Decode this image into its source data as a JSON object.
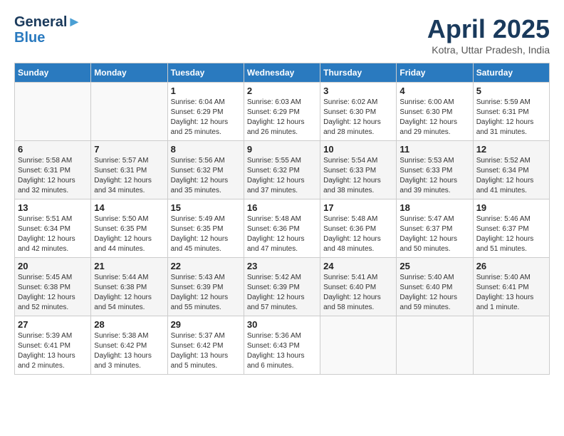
{
  "header": {
    "logo_line1": "General",
    "logo_line2": "Blue",
    "month_title": "April 2025",
    "location": "Kotra, Uttar Pradesh, India"
  },
  "weekdays": [
    "Sunday",
    "Monday",
    "Tuesday",
    "Wednesday",
    "Thursday",
    "Friday",
    "Saturday"
  ],
  "weeks": [
    [
      {
        "day": "",
        "sunrise": "",
        "sunset": "",
        "daylight": ""
      },
      {
        "day": "",
        "sunrise": "",
        "sunset": "",
        "daylight": ""
      },
      {
        "day": "1",
        "sunrise": "Sunrise: 6:04 AM",
        "sunset": "Sunset: 6:29 PM",
        "daylight": "Daylight: 12 hours and 25 minutes."
      },
      {
        "day": "2",
        "sunrise": "Sunrise: 6:03 AM",
        "sunset": "Sunset: 6:29 PM",
        "daylight": "Daylight: 12 hours and 26 minutes."
      },
      {
        "day": "3",
        "sunrise": "Sunrise: 6:02 AM",
        "sunset": "Sunset: 6:30 PM",
        "daylight": "Daylight: 12 hours and 28 minutes."
      },
      {
        "day": "4",
        "sunrise": "Sunrise: 6:00 AM",
        "sunset": "Sunset: 6:30 PM",
        "daylight": "Daylight: 12 hours and 29 minutes."
      },
      {
        "day": "5",
        "sunrise": "Sunrise: 5:59 AM",
        "sunset": "Sunset: 6:31 PM",
        "daylight": "Daylight: 12 hours and 31 minutes."
      }
    ],
    [
      {
        "day": "6",
        "sunrise": "Sunrise: 5:58 AM",
        "sunset": "Sunset: 6:31 PM",
        "daylight": "Daylight: 12 hours and 32 minutes."
      },
      {
        "day": "7",
        "sunrise": "Sunrise: 5:57 AM",
        "sunset": "Sunset: 6:31 PM",
        "daylight": "Daylight: 12 hours and 34 minutes."
      },
      {
        "day": "8",
        "sunrise": "Sunrise: 5:56 AM",
        "sunset": "Sunset: 6:32 PM",
        "daylight": "Daylight: 12 hours and 35 minutes."
      },
      {
        "day": "9",
        "sunrise": "Sunrise: 5:55 AM",
        "sunset": "Sunset: 6:32 PM",
        "daylight": "Daylight: 12 hours and 37 minutes."
      },
      {
        "day": "10",
        "sunrise": "Sunrise: 5:54 AM",
        "sunset": "Sunset: 6:33 PM",
        "daylight": "Daylight: 12 hours and 38 minutes."
      },
      {
        "day": "11",
        "sunrise": "Sunrise: 5:53 AM",
        "sunset": "Sunset: 6:33 PM",
        "daylight": "Daylight: 12 hours and 39 minutes."
      },
      {
        "day": "12",
        "sunrise": "Sunrise: 5:52 AM",
        "sunset": "Sunset: 6:34 PM",
        "daylight": "Daylight: 12 hours and 41 minutes."
      }
    ],
    [
      {
        "day": "13",
        "sunrise": "Sunrise: 5:51 AM",
        "sunset": "Sunset: 6:34 PM",
        "daylight": "Daylight: 12 hours and 42 minutes."
      },
      {
        "day": "14",
        "sunrise": "Sunrise: 5:50 AM",
        "sunset": "Sunset: 6:35 PM",
        "daylight": "Daylight: 12 hours and 44 minutes."
      },
      {
        "day": "15",
        "sunrise": "Sunrise: 5:49 AM",
        "sunset": "Sunset: 6:35 PM",
        "daylight": "Daylight: 12 hours and 45 minutes."
      },
      {
        "day": "16",
        "sunrise": "Sunrise: 5:48 AM",
        "sunset": "Sunset: 6:36 PM",
        "daylight": "Daylight: 12 hours and 47 minutes."
      },
      {
        "day": "17",
        "sunrise": "Sunrise: 5:48 AM",
        "sunset": "Sunset: 6:36 PM",
        "daylight": "Daylight: 12 hours and 48 minutes."
      },
      {
        "day": "18",
        "sunrise": "Sunrise: 5:47 AM",
        "sunset": "Sunset: 6:37 PM",
        "daylight": "Daylight: 12 hours and 50 minutes."
      },
      {
        "day": "19",
        "sunrise": "Sunrise: 5:46 AM",
        "sunset": "Sunset: 6:37 PM",
        "daylight": "Daylight: 12 hours and 51 minutes."
      }
    ],
    [
      {
        "day": "20",
        "sunrise": "Sunrise: 5:45 AM",
        "sunset": "Sunset: 6:38 PM",
        "daylight": "Daylight: 12 hours and 52 minutes."
      },
      {
        "day": "21",
        "sunrise": "Sunrise: 5:44 AM",
        "sunset": "Sunset: 6:38 PM",
        "daylight": "Daylight: 12 hours and 54 minutes."
      },
      {
        "day": "22",
        "sunrise": "Sunrise: 5:43 AM",
        "sunset": "Sunset: 6:39 PM",
        "daylight": "Daylight: 12 hours and 55 minutes."
      },
      {
        "day": "23",
        "sunrise": "Sunrise: 5:42 AM",
        "sunset": "Sunset: 6:39 PM",
        "daylight": "Daylight: 12 hours and 57 minutes."
      },
      {
        "day": "24",
        "sunrise": "Sunrise: 5:41 AM",
        "sunset": "Sunset: 6:40 PM",
        "daylight": "Daylight: 12 hours and 58 minutes."
      },
      {
        "day": "25",
        "sunrise": "Sunrise: 5:40 AM",
        "sunset": "Sunset: 6:40 PM",
        "daylight": "Daylight: 12 hours and 59 minutes."
      },
      {
        "day": "26",
        "sunrise": "Sunrise: 5:40 AM",
        "sunset": "Sunset: 6:41 PM",
        "daylight": "Daylight: 13 hours and 1 minute."
      }
    ],
    [
      {
        "day": "27",
        "sunrise": "Sunrise: 5:39 AM",
        "sunset": "Sunset: 6:41 PM",
        "daylight": "Daylight: 13 hours and 2 minutes."
      },
      {
        "day": "28",
        "sunrise": "Sunrise: 5:38 AM",
        "sunset": "Sunset: 6:42 PM",
        "daylight": "Daylight: 13 hours and 3 minutes."
      },
      {
        "day": "29",
        "sunrise": "Sunrise: 5:37 AM",
        "sunset": "Sunset: 6:42 PM",
        "daylight": "Daylight: 13 hours and 5 minutes."
      },
      {
        "day": "30",
        "sunrise": "Sunrise: 5:36 AM",
        "sunset": "Sunset: 6:43 PM",
        "daylight": "Daylight: 13 hours and 6 minutes."
      },
      {
        "day": "",
        "sunrise": "",
        "sunset": "",
        "daylight": ""
      },
      {
        "day": "",
        "sunrise": "",
        "sunset": "",
        "daylight": ""
      },
      {
        "day": "",
        "sunrise": "",
        "sunset": "",
        "daylight": ""
      }
    ]
  ]
}
